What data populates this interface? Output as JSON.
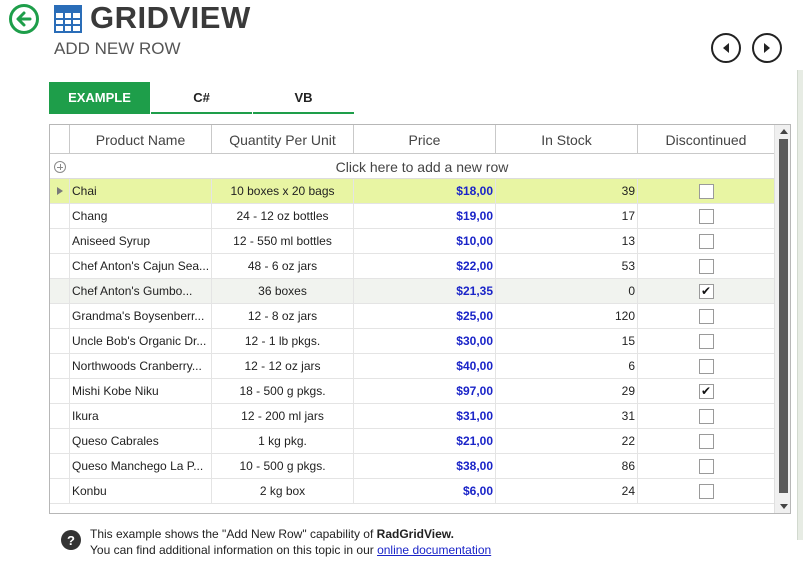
{
  "header": {
    "title": "GRIDVIEW",
    "subtitle": "ADD NEW ROW",
    "icons": {
      "back": "back-arrow-icon",
      "grid": "grid-icon",
      "prev": "previous-icon",
      "next": "next-icon"
    }
  },
  "tabs": [
    {
      "label": "EXAMPLE",
      "active": true
    },
    {
      "label": "C#",
      "active": false
    },
    {
      "label": "VB",
      "active": false
    }
  ],
  "grid": {
    "columns": [
      "Product Name",
      "Quantity Per Unit",
      "Price",
      "In Stock",
      "Discontinued"
    ],
    "add_row_text": "Click here to add a new row",
    "rows": [
      {
        "name": "Chai",
        "qty": "10 boxes x 20 bags",
        "price": "$18,00",
        "stock": "39",
        "discontinued": false,
        "current": true
      },
      {
        "name": "Chang",
        "qty": "24 - 12 oz bottles",
        "price": "$19,00",
        "stock": "17",
        "discontinued": false
      },
      {
        "name": "Aniseed Syrup",
        "qty": "12 - 550 ml bottles",
        "price": "$10,00",
        "stock": "13",
        "discontinued": false
      },
      {
        "name": "Chef Anton's Cajun Sea...",
        "qty": "48 - 6 oz jars",
        "price": "$22,00",
        "stock": "53",
        "discontinued": false
      },
      {
        "name": "Chef Anton's Gumbo...",
        "qty": "36 boxes",
        "price": "$21,35",
        "stock": "0",
        "discontinued": true,
        "hover": true
      },
      {
        "name": "Grandma's Boysenberr...",
        "qty": "12 - 8 oz jars",
        "price": "$25,00",
        "stock": "120",
        "discontinued": false
      },
      {
        "name": "Uncle Bob's Organic Dr...",
        "qty": "12 - 1 lb pkgs.",
        "price": "$30,00",
        "stock": "15",
        "discontinued": false
      },
      {
        "name": "Northwoods Cranberry...",
        "qty": "12 - 12 oz jars",
        "price": "$40,00",
        "stock": "6",
        "discontinued": false
      },
      {
        "name": "Mishi Kobe Niku",
        "qty": "18 - 500 g pkgs.",
        "price": "$97,00",
        "stock": "29",
        "discontinued": true
      },
      {
        "name": "Ikura",
        "qty": "12 - 200 ml jars",
        "price": "$31,00",
        "stock": "31",
        "discontinued": false
      },
      {
        "name": "Queso Cabrales",
        "qty": "1 kg pkg.",
        "price": "$21,00",
        "stock": "22",
        "discontinued": false
      },
      {
        "name": "Queso Manchego La P...",
        "qty": "10 - 500 g pkgs.",
        "price": "$38,00",
        "stock": "86",
        "discontinued": false
      },
      {
        "name": "Konbu",
        "qty": "2 kg box",
        "price": "$6,00",
        "stock": "24",
        "discontinued": false
      }
    ]
  },
  "info": {
    "line1_prefix": "This example shows the \"Add New Row\" capability of ",
    "line1_bold": "RadGridView.",
    "line2_prefix": "You can find additional information on this topic in our ",
    "link_text": "online documentation",
    "help_glyph": "?"
  }
}
